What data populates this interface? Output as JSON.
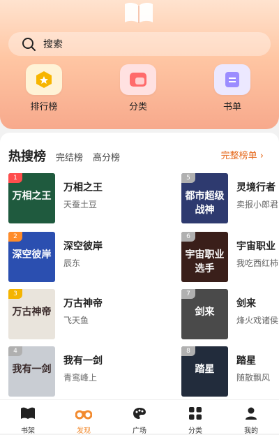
{
  "search": {
    "placeholder": "搜索"
  },
  "quick_links": [
    {
      "label": "排行榜",
      "icon": "ranking-badge-icon"
    },
    {
      "label": "分类",
      "icon": "category-icon"
    },
    {
      "label": "书单",
      "icon": "booklist-icon"
    }
  ],
  "tabs": {
    "main": "热搜榜",
    "second": "完结榜",
    "third": "高分榜",
    "more": "完整榜单 ›"
  },
  "books": [
    {
      "rank": "1",
      "title": "万相之王",
      "author": "天蚕土豆",
      "cover_text": "万相之王",
      "cover_color": "#1f5a3e",
      "rank_color": "#ff4d4d"
    },
    {
      "rank": "5",
      "title": "灵境行者",
      "author": "卖报小郎君",
      "cover_text": "都市超级战神",
      "cover_color": "#2e3a6f",
      "rank_color": "#b0b0b0"
    },
    {
      "rank": "2",
      "title": "深空彼岸",
      "author": "辰东",
      "cover_text": "深空彼岸",
      "cover_color": "#2b4fb0",
      "rank_color": "#ff8c2a"
    },
    {
      "rank": "6",
      "title": "宇宙职业",
      "author": "我吃西红柿",
      "cover_text": "宇宙职业选手",
      "cover_color": "#3a1f1a",
      "rank_color": "#b0b0b0"
    },
    {
      "rank": "3",
      "title": "万古神帝",
      "author": "飞天鱼",
      "cover_text": "万古神帝",
      "cover_color": "#e9e4dc",
      "rank_color": "#f4b400"
    },
    {
      "rank": "7",
      "title": "剑来",
      "author": "烽火戏诸侯",
      "cover_text": "剑来",
      "cover_color": "#4a4a4a",
      "rank_color": "#b0b0b0"
    },
    {
      "rank": "4",
      "title": "我有一剑",
      "author": "青鸾峰上",
      "cover_text": "我有一剑",
      "cover_color": "#c9cdd3",
      "rank_color": "#b0b0b0"
    },
    {
      "rank": "8",
      "title": "踏星",
      "author": "随散飘风",
      "cover_text": "踏星",
      "cover_color": "#222c3c",
      "rank_color": "#b0b0b0"
    }
  ],
  "nav": [
    {
      "label": "书架",
      "icon": "bookshelf-icon"
    },
    {
      "label": "发现",
      "icon": "discover-icon",
      "active": true
    },
    {
      "label": "广场",
      "icon": "palette-icon"
    },
    {
      "label": "分类",
      "icon": "grid-icon"
    },
    {
      "label": "我的",
      "icon": "person-icon"
    }
  ],
  "colors": {
    "accent": "#f28a2e",
    "more_link": "#e66a1d"
  }
}
